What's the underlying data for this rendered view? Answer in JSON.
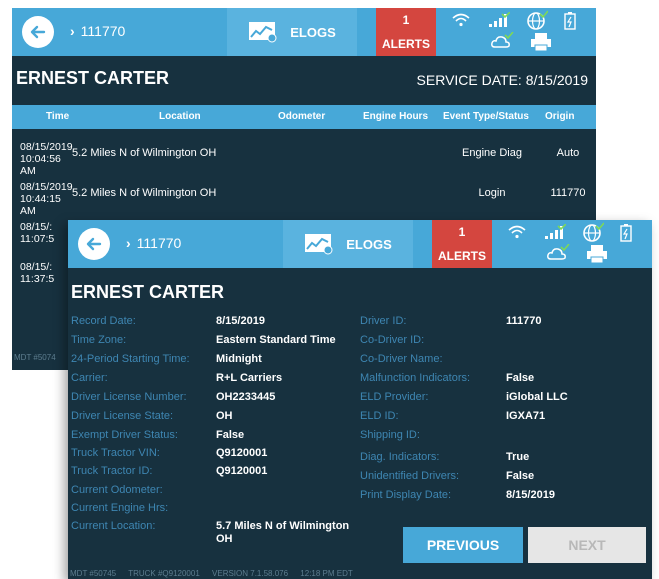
{
  "colors": {
    "topbar": "#47a8d8",
    "alerts": "#d4463f",
    "background": "#17313f",
    "label": "#3e86b2"
  },
  "icons": [
    "back-arrow-icon",
    "chevron-right-icon",
    "elogs-chart-icon",
    "wifi-icon",
    "signal-bars-icon",
    "globe-icon",
    "battery-icon",
    "cloud-icon",
    "printer-icon"
  ],
  "back_screen": {
    "breadcrumb": "111770",
    "elogs_label": "ELOGS",
    "alerts_count": "1",
    "alerts_label": "ALERTS",
    "driver_name": "ERNEST CARTER",
    "service_date": "SERVICE DATE: 8/15/2019",
    "columns": [
      "Time",
      "Location",
      "Odometer",
      "Engine Hours",
      "Event Type/Status",
      "Origin"
    ],
    "rows": [
      {
        "date": "08/15/2019",
        "time": "10:04:56 AM",
        "location": "5.2 Miles N of Wilmington OH",
        "event": "Engine Diag",
        "origin": "Auto"
      },
      {
        "date": "08/15/2019",
        "time": "10:44:15 AM",
        "location": "5.2 Miles N of Wilmington OH",
        "event": "Login",
        "origin": "111770"
      },
      {
        "date": "08/15/:",
        "time": "11:07:5"
      },
      {
        "date": "08/15/:",
        "time": "11:37:5"
      }
    ],
    "footer": "MDT #5074"
  },
  "front_screen": {
    "breadcrumb": "111770",
    "elogs_label": "ELOGS",
    "alerts_count": "1",
    "alerts_label": "ALERTS",
    "driver_name": "ERNEST CARTER",
    "left_fields": [
      {
        "label": "Record Date:",
        "value": "8/15/2019"
      },
      {
        "label": "Time Zone:",
        "value": "Eastern Standard Time"
      },
      {
        "label": "24-Period Starting Time:",
        "value": "Midnight"
      },
      {
        "label": "Carrier:",
        "value": "R+L Carriers"
      },
      {
        "label": "Driver License Number:",
        "value": "OH2233445"
      },
      {
        "label": "Driver License State:",
        "value": "OH"
      },
      {
        "label": "Exempt Driver Status:",
        "value": "False"
      },
      {
        "label": "Truck Tractor VIN:",
        "value": "Q9120001"
      },
      {
        "label": "Truck Tractor ID:",
        "value": "Q9120001"
      },
      {
        "label": "Current Odometer:",
        "value": ""
      },
      {
        "label": "Current Engine Hrs:",
        "value": ""
      },
      {
        "label": "Current Location:",
        "value": "5.7 Miles N of Wilmington",
        "value2": "OH"
      }
    ],
    "right_fields": [
      {
        "label": "Driver ID:",
        "value": "111770"
      },
      {
        "label": "Co-Driver ID:",
        "value": ""
      },
      {
        "label": "Co-Driver Name:",
        "value": ""
      },
      {
        "label": "Malfunction Indicators:",
        "value": "False"
      },
      {
        "label": "ELD Provider:",
        "value": "iGlobal LLC"
      },
      {
        "label": "ELD ID:",
        "value": "IGXA71"
      },
      {
        "label": "Shipping ID:",
        "value": ""
      },
      {
        "label": "Diag. Indicators:",
        "value": "True"
      },
      {
        "label": "Unidentified Drivers:",
        "value": "False"
      },
      {
        "label": "Print Display Date:",
        "value": "8/15/2019"
      }
    ],
    "previous_label": "PREVIOUS",
    "next_label": "NEXT",
    "footer": {
      "mdt": "MDT #50745",
      "truck": "TRUCK #Q9120001",
      "version": "VERSION  7.1.58.076",
      "time": "12:18 PM EDT"
    }
  }
}
